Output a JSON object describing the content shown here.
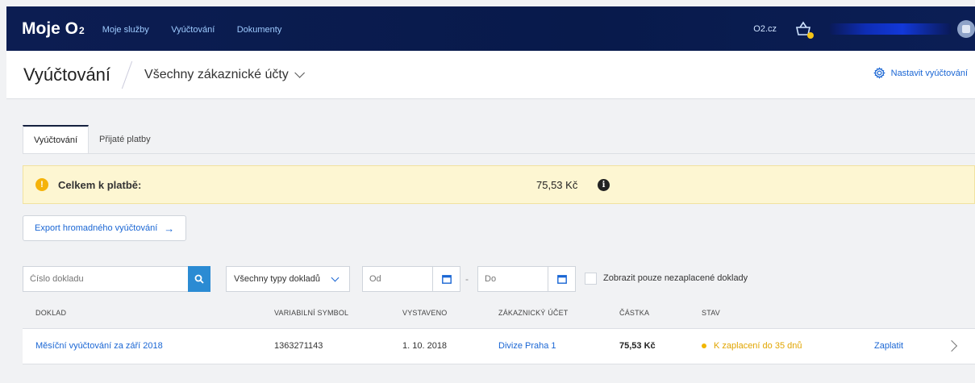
{
  "topbar": {
    "brand": "Moje O",
    "brand_sub": "2",
    "nav": [
      "Moje služby",
      "Vyúčtování",
      "Dokumenty"
    ],
    "o2_link": "O2.cz"
  },
  "header": {
    "title": "Vyúčtování",
    "account_select": "Všechny zákaznické účty",
    "settings_label": "Nastavit vyúčtování"
  },
  "tabs": [
    {
      "label": "Vyúčtování",
      "active": true
    },
    {
      "label": "Přijaté platby",
      "active": false
    }
  ],
  "total": {
    "label": "Celkem k platbě:",
    "amount": "75,53 Kč"
  },
  "export_button": "Export hromadného vyúčtování",
  "filters": {
    "doc_number_placeholder": "Číslo dokladu",
    "doc_type": "Všechny typy dokladů",
    "from_placeholder": "Od",
    "to_placeholder": "Do",
    "unpaid_only_label": "Zobrazit pouze nezaplacené doklady"
  },
  "table": {
    "columns": [
      "Doklad",
      "Variabilní symbol",
      "Vystaveno",
      "Zákaznický účet",
      "Částka",
      "Stav"
    ],
    "rows": [
      {
        "doklad": "Měsíční vyúčtování za září 2018",
        "variabilni_symbol": "1363271143",
        "vystaveno": "1. 10. 2018",
        "ucet": "Divize Praha 1",
        "castka": "75,53 Kč",
        "stav": "K zaplacení do 35 dnů",
        "action": "Zaplatit"
      }
    ]
  },
  "colors": {
    "topbar": "#0c1d52",
    "link": "#1a66d4",
    "warning_bg": "#fdf6d2",
    "status_due": "#e1a500"
  }
}
